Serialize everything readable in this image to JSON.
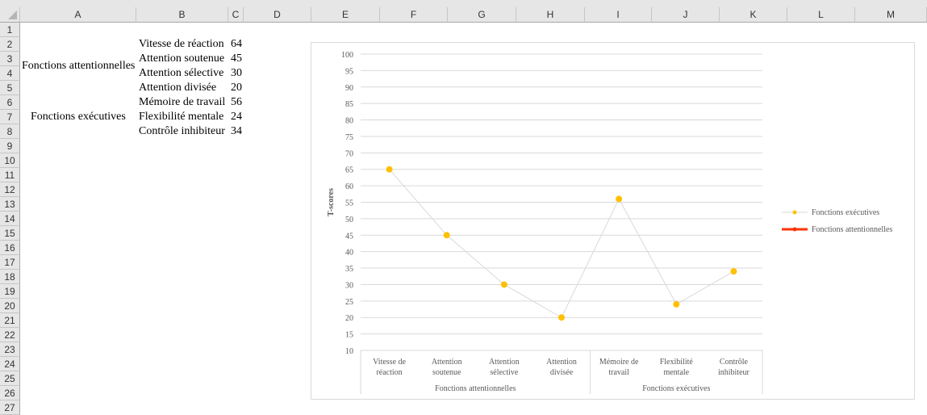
{
  "sheet": {
    "columns": [
      "A",
      "B",
      "C",
      "D",
      "E",
      "F",
      "G",
      "H",
      "I",
      "J",
      "K",
      "L",
      "M"
    ],
    "rows": [
      "1",
      "2",
      "3",
      "4",
      "5",
      "6",
      "7",
      "8",
      "9",
      "10",
      "11",
      "12",
      "13",
      "14",
      "15",
      "16",
      "17",
      "18",
      "19",
      "20",
      "21",
      "22",
      "23",
      "24",
      "25",
      "26",
      "27"
    ],
    "groups": [
      "Fonctions attentionnelles",
      "Fonctions exécutives"
    ],
    "items": [
      {
        "label": "Vitesse de réaction",
        "value": "64"
      },
      {
        "label": "Attention soutenue",
        "value": "45"
      },
      {
        "label": "Attention sélective",
        "value": "30"
      },
      {
        "label": "Attention divisée",
        "value": "20"
      },
      {
        "label": "Mémoire de travail",
        "value": "56"
      },
      {
        "label": "Flexibilité mentale",
        "value": "24"
      },
      {
        "label": "Contrôle inhibiteur",
        "value": "34"
      }
    ]
  },
  "chart_data": {
    "type": "line",
    "categories": [
      [
        "Vitesse de",
        "réaction"
      ],
      [
        "Attention",
        "soutenue"
      ],
      [
        "Attention",
        "sélective"
      ],
      [
        "Attention",
        "divisée"
      ],
      [
        "Mémoire de",
        "travail"
      ],
      [
        "Flexibilité",
        "mentale"
      ],
      [
        "Contrôle",
        "inhibiteur"
      ]
    ],
    "category_groups": [
      {
        "label": "Fonctions attentionnelles",
        "count": 4
      },
      {
        "label": "Fonctions exécutives",
        "count": 3
      }
    ],
    "series": [
      {
        "name": "Fonctions exécutives",
        "values": [
          65,
          45,
          30,
          20,
          56,
          24,
          34
        ],
        "line_color": "#d9d9d9",
        "marker_color": "#ffc000"
      },
      {
        "name": "Fonctions attentionnelles",
        "values": [],
        "line_color": "#ff3300",
        "marker_color": "#ff3300"
      }
    ],
    "ylabel": "T-scores",
    "ylim": [
      10,
      100
    ],
    "yticks": [
      10,
      15,
      20,
      25,
      30,
      35,
      40,
      45,
      50,
      55,
      60,
      65,
      70,
      75,
      80,
      85,
      90,
      95,
      100
    ],
    "grid": true,
    "legend": "right"
  }
}
